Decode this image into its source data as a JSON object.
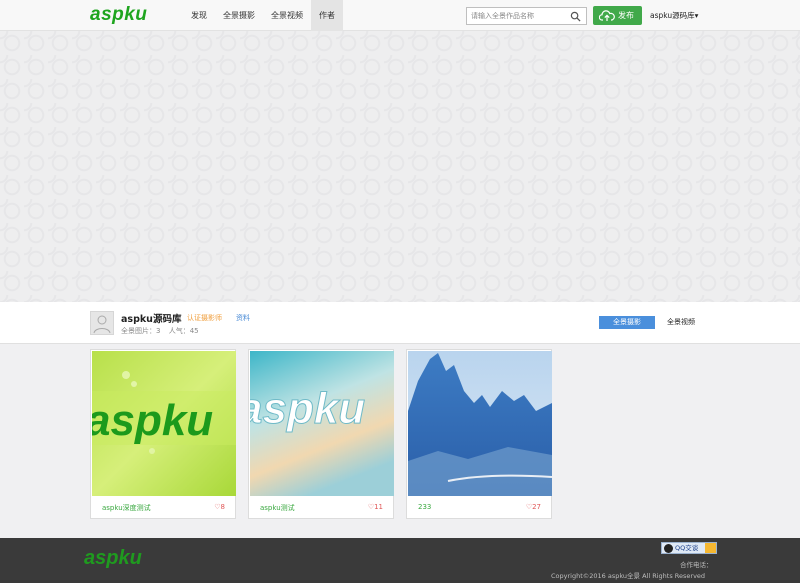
{
  "header": {
    "logo": "aspku",
    "nav": [
      "发现",
      "全景摄影",
      "全景视频",
      "作者"
    ],
    "search_placeholder": "请输入全景作品名称",
    "publish_label": "发布",
    "user_label": "aspku源码库▾"
  },
  "profile": {
    "name": "aspku源码库",
    "cert": "认证摄影师",
    "info_link": "资料",
    "stat_photos": "全景图片：3",
    "stat_popularity": "人气：45",
    "tab_photo": "全景摄影",
    "tab_video": "全景视频"
  },
  "works": [
    {
      "title": "aspku深度测试",
      "likes": "♡8"
    },
    {
      "title": "aspku测试",
      "likes": "♡11"
    },
    {
      "title": "233",
      "likes": "♡27"
    }
  ],
  "footer": {
    "logo": "aspku",
    "qq_label": "QQ交谈",
    "tel_label": "合作电话：",
    "copyright": "Copyright©2016 aspku全景 All Rights Reserved"
  },
  "colors": {
    "brand_green": "#1fa51f",
    "publish_green": "#41a94a",
    "tab_blue": "#4a8fdc",
    "footer_bg": "#3a3a3a"
  }
}
